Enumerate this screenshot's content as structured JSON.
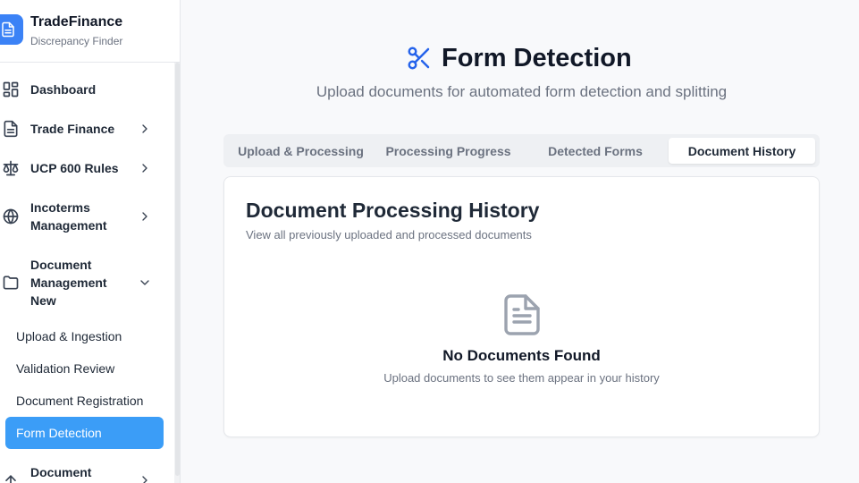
{
  "brand": {
    "title": "TradeFinance",
    "subtitle": "Discrepancy Finder"
  },
  "sidebar": {
    "items": [
      {
        "label": "Dashboard",
        "icon": "dashboard-grid-icon"
      },
      {
        "label": "Trade Finance",
        "icon": "file-text-icon",
        "chevron": "chevron-right"
      },
      {
        "label": "UCP 600 Rules",
        "icon": "scale-icon",
        "chevron": "chevron-right"
      },
      {
        "label": "Incoterms\nManagement",
        "icon": "globe-icon",
        "chevron": "chevron-right"
      },
      {
        "label": "Document\nManagement\nNew",
        "icon": "folder-icon",
        "chevron": "chevron-down"
      },
      {
        "label": "Document",
        "icon": "upload-arrow-icon",
        "chevron": "chevron-right"
      }
    ],
    "subitems": [
      {
        "label": "Upload & Ingestion",
        "active": false
      },
      {
        "label": "Validation Review",
        "active": false
      },
      {
        "label": "Document Registration",
        "active": false
      },
      {
        "label": "Form Detection",
        "active": true
      }
    ]
  },
  "header": {
    "title": "Form Detection",
    "subtitle": "Upload documents for automated form detection and splitting",
    "icon": "scissors-icon"
  },
  "tabs": [
    {
      "label": "Upload & Processing",
      "active": false
    },
    {
      "label": "Processing Progress",
      "active": false
    },
    {
      "label": "Detected Forms",
      "active": false
    },
    {
      "label": "Document History",
      "active": true
    }
  ],
  "history": {
    "title": "Document Processing History",
    "subtitle": "View all previously uploaded and processed documents",
    "empty_icon": "file-document-icon",
    "empty_title": "No Documents Found",
    "empty_subtitle": "Upload documents to see them appear in your history"
  },
  "colors": {
    "accent": "#3b9df7",
    "brand": "#3b82f6",
    "title_icon": "#2563eb"
  }
}
